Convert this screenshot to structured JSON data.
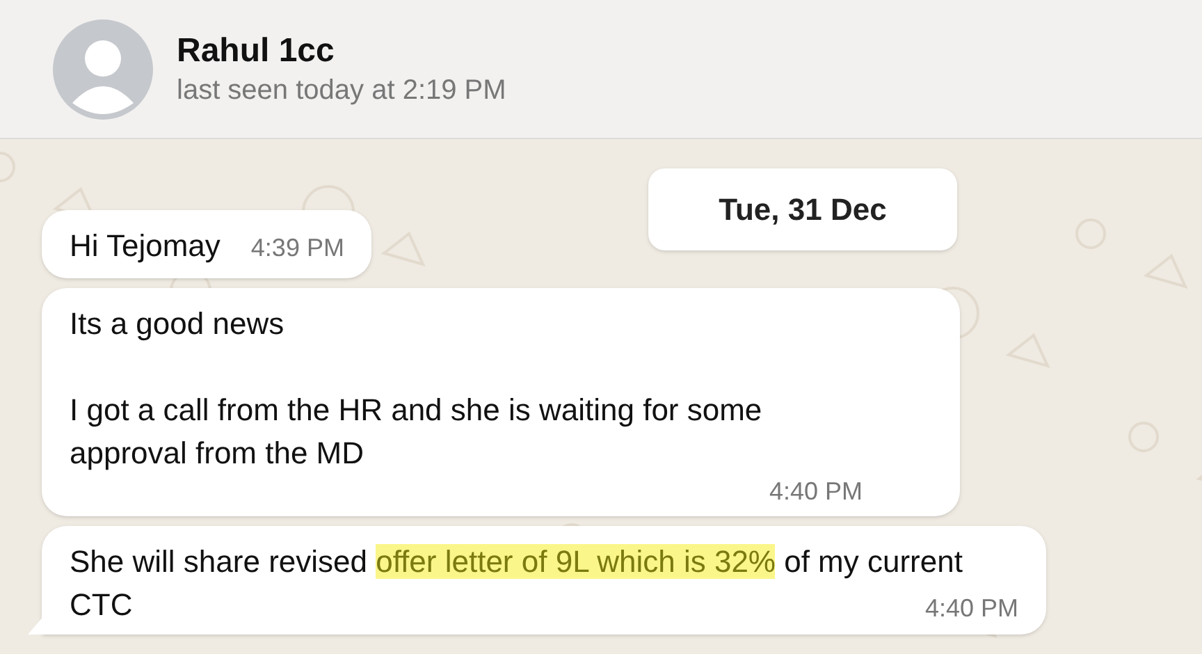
{
  "header": {
    "name": "Rahul 1cc",
    "status": "last seen today at 2:19 PM"
  },
  "date_divider": "Tue, 31 Dec",
  "messages": [
    {
      "paragraphs": [
        [
          {
            "text": "Hi Tejomay",
            "highlighted": false
          }
        ]
      ],
      "time": "4:39 PM",
      "tail": false
    },
    {
      "paragraphs": [
        [
          {
            "text": "Its a good news",
            "highlighted": false
          }
        ],
        [
          {
            "text": "I got a call from the HR and she is waiting for some approval from the MD",
            "highlighted": false
          }
        ]
      ],
      "time": "4:40 PM",
      "tail": false
    },
    {
      "paragraphs": [
        [
          {
            "text": "She will share revised ",
            "highlighted": false
          },
          {
            "text": "offer  letter of 9L which is 32%",
            "highlighted": true
          },
          {
            "text": " of my current CTC",
            "highlighted": false
          }
        ]
      ],
      "time": "4:40 PM",
      "tail": true
    }
  ]
}
